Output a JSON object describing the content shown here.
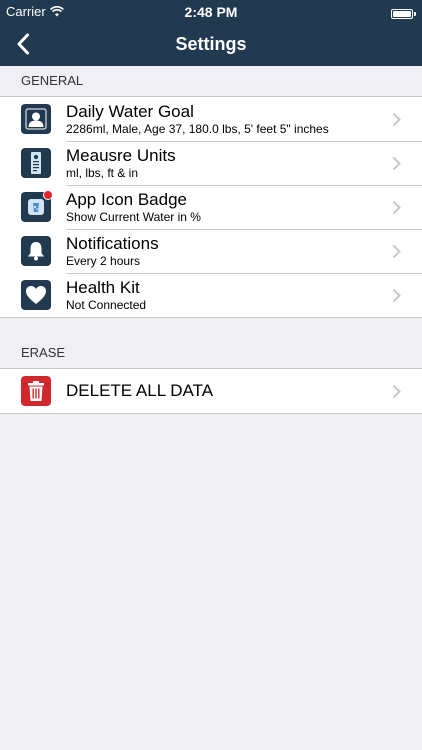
{
  "status_bar": {
    "carrier": "Carrier",
    "time": "2:48 PM"
  },
  "nav": {
    "title": "Settings"
  },
  "colors": {
    "navbar": "#213a4f",
    "icon_blue": "#213a4f",
    "icon_red": "#d0282d",
    "background": "#efeff4"
  },
  "general": {
    "header": "GENERAL",
    "items": [
      {
        "label": "Daily Water Goal",
        "detail": "2286ml, Male, Age 37, 180.0 lbs, 5' feet 5\" inches",
        "icon": "user-profile-icon"
      },
      {
        "label": "Meausre Units",
        "detail": "ml, lbs, ft & in",
        "icon": "measuring-units-icon"
      },
      {
        "label": "App Icon Badge",
        "detail": "Show Current Water in %",
        "icon": "app-badge-icon"
      },
      {
        "label": "Notifications",
        "detail": "Every 2 hours",
        "icon": "bell-icon"
      },
      {
        "label": "Health Kit",
        "detail": "Not Connected",
        "icon": "heart-icon"
      }
    ]
  },
  "erase": {
    "header": "ERASE",
    "items": [
      {
        "label": "DELETE ALL DATA",
        "icon": "trash-icon"
      }
    ]
  }
}
